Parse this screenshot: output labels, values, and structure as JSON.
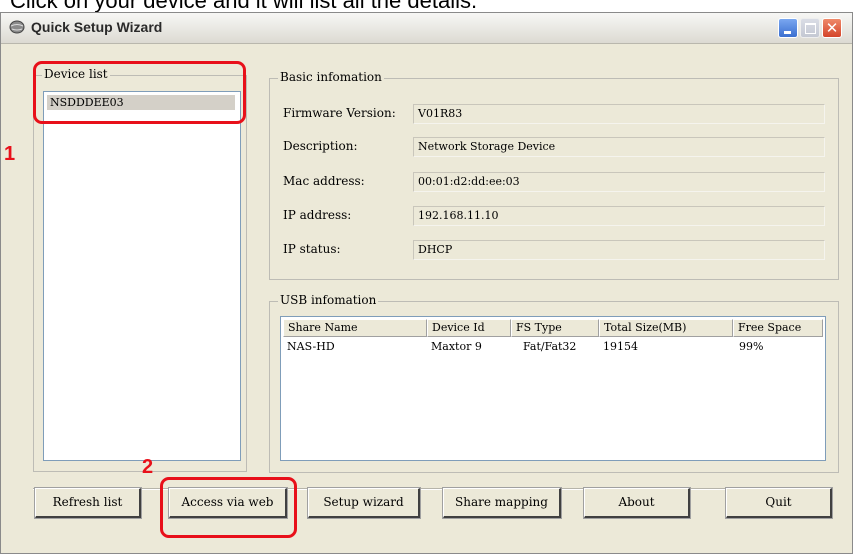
{
  "caption": "Click on your device and it will list all the details.",
  "window": {
    "title": "Quick Setup Wizard"
  },
  "device_list": {
    "label": "Device list",
    "items": [
      "NSDDDEE03"
    ]
  },
  "basic_info": {
    "label": "Basic infomation",
    "fields": [
      {
        "label": "Firmware Version:",
        "value": "V01R83"
      },
      {
        "label": "Description:",
        "value": "Network Storage Device"
      },
      {
        "label": "Mac address:",
        "value": "00:01:d2:dd:ee:03"
      },
      {
        "label": "IP address:",
        "value": "192.168.11.10"
      },
      {
        "label": "IP status:",
        "value": "DHCP"
      }
    ]
  },
  "usb_info": {
    "label": "USB infomation",
    "columns": [
      "Share Name",
      "Device Id",
      "FS Type",
      "Total Size(MB)",
      "Free Space"
    ],
    "rows": [
      [
        "NAS-HD",
        "Maxtor 9",
        "Fat/Fat32",
        "19154",
        "99%"
      ]
    ]
  },
  "buttons": {
    "refresh": "Refresh list",
    "access": "Access via web",
    "setup": "Setup wizard",
    "share": "Share mapping",
    "about": "About",
    "quit": "Quit"
  },
  "annotations": {
    "one": "1",
    "two": "2",
    "color": "#e8101a"
  }
}
